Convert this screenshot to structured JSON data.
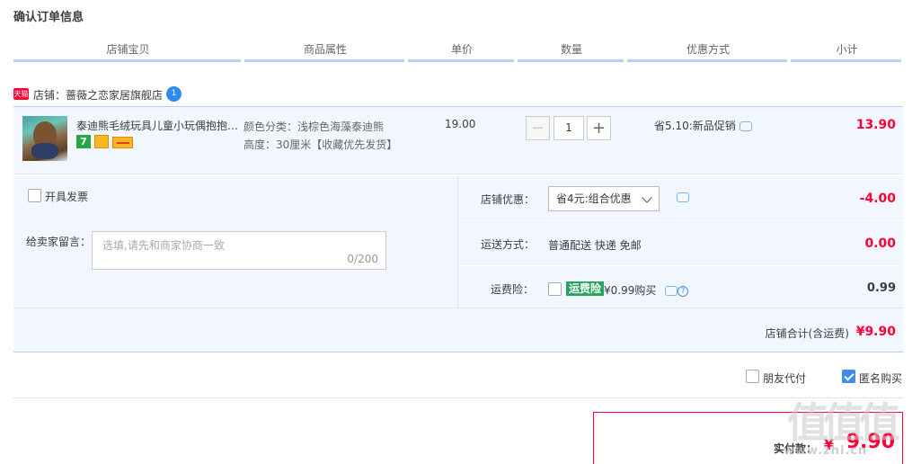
{
  "page_title": "确认订单信息",
  "columns": [
    "店铺宝贝",
    "商品属性",
    "单价",
    "数量",
    "优惠方式",
    "小计"
  ],
  "shop": {
    "badge": "天猫",
    "label": "店铺：蔷薇之恋家居旗舰店",
    "chat_badge": "1"
  },
  "item": {
    "name": "泰迪熊毛绒玩具儿童小玩偶抱抱…",
    "badge_7": "7",
    "props_color": "颜色分类：浅棕色海藻泰迪熊",
    "props_height": "高度：30厘米【收藏优先发货】",
    "unit_price": "19.00",
    "quantity": "1",
    "minus": "−",
    "plus": "+",
    "promo": "省5.10:新品促销",
    "subtotal": "13.90"
  },
  "invoice": {
    "label": "开具发票"
  },
  "message": {
    "label": "给卖家留言：",
    "placeholder": "选填,请先和商家协商一致",
    "counter": "0/200"
  },
  "shop_discount": {
    "label": "店铺优惠：",
    "selected": "省4元:组合优惠",
    "value": "-4.00"
  },
  "shipping": {
    "label": "运送方式：",
    "text": "普通配送 快递 免邮",
    "value": "0.00"
  },
  "insurance": {
    "label": "运费险：",
    "tag": "运费险",
    "price": "¥0.99购买",
    "help": "?",
    "value": "0.99"
  },
  "shop_total": {
    "label": "店铺合计(含运费)",
    "value": "¥9.90"
  },
  "options": {
    "friend_pay": "朋友代付",
    "anonymous": "匿名购买"
  },
  "payment": {
    "label": "实付款：",
    "currency": "¥",
    "value": "9.90"
  },
  "watermark": {
    "text": "值值值",
    "url": "www.zhi.cn"
  },
  "colors": {
    "accent_red": "#ff0036",
    "header_bar": "#b2d1ff",
    "panel_bg": "#f2f7ff",
    "check_blue": "#3c8bed",
    "insurance_green": "#27a45e"
  }
}
